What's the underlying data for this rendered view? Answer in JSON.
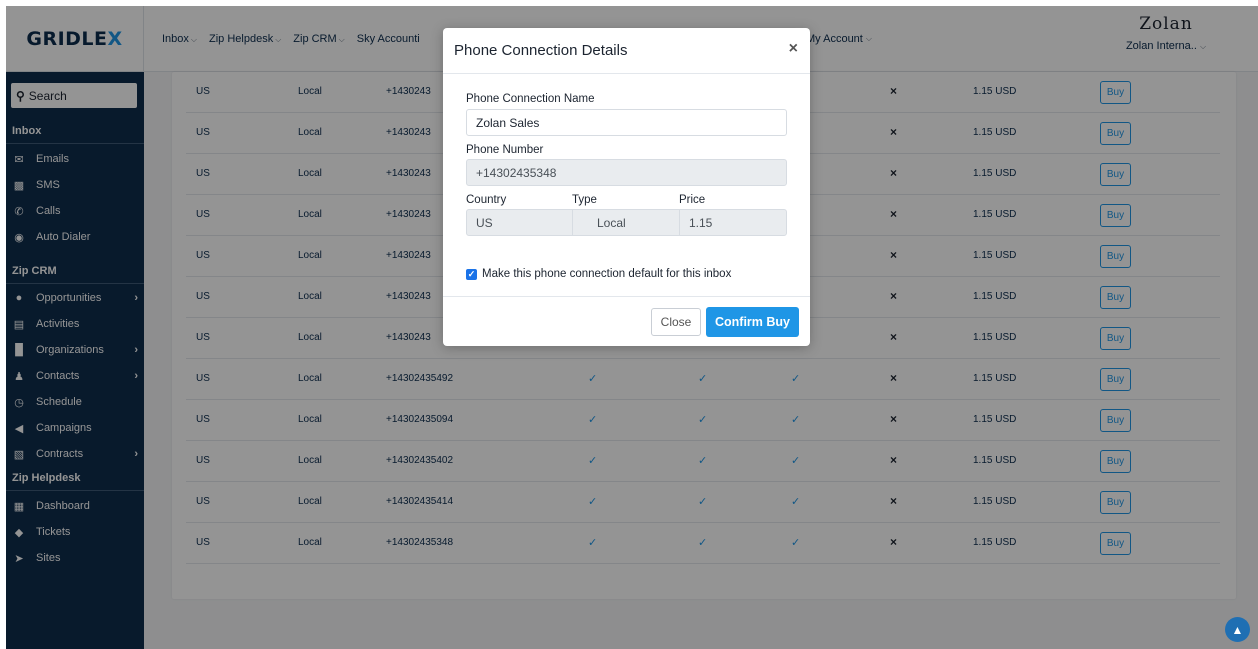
{
  "brand": {
    "name_part1": "GRIDLE",
    "name_part2": "X"
  },
  "topnav": {
    "items": [
      {
        "label": "Inbox"
      },
      {
        "label": "Zip Helpdesk"
      },
      {
        "label": "Zip CRM"
      },
      {
        "label": "Sky Accounti"
      }
    ],
    "my_account": "My Account",
    "company_logo": "Zolan",
    "company_name": "Zolan Interna.."
  },
  "sidebar": {
    "search_placeholder": "Search",
    "sections": {
      "inbox": "Inbox",
      "zip_crm": "Zip CRM",
      "zip_helpdesk": "Zip Helpdesk"
    },
    "inbox_items": [
      {
        "label": "Emails",
        "icon": "envelope-icon"
      },
      {
        "label": "SMS",
        "icon": "chat-icon"
      },
      {
        "label": "Calls",
        "icon": "phone-icon"
      },
      {
        "label": "Auto Dialer",
        "icon": "dialer-icon"
      }
    ],
    "crm_items": [
      {
        "label": "Opportunities",
        "icon": "lightbulb-icon",
        "has_arrow": true
      },
      {
        "label": "Activities",
        "icon": "activity-icon",
        "has_arrow": false
      },
      {
        "label": "Organizations",
        "icon": "building-icon",
        "has_arrow": true
      },
      {
        "label": "Contacts",
        "icon": "user-icon",
        "has_arrow": true
      },
      {
        "label": "Schedule",
        "icon": "clock-icon",
        "has_arrow": false
      },
      {
        "label": "Campaigns",
        "icon": "megaphone-icon",
        "has_arrow": false
      },
      {
        "label": "Contracts",
        "icon": "file-icon",
        "has_arrow": true
      }
    ],
    "helpdesk_items": [
      {
        "label": "Dashboard",
        "icon": "dashboard-icon"
      },
      {
        "label": "Tickets",
        "icon": "tag-icon"
      },
      {
        "label": "Sites",
        "icon": "cursor-icon"
      }
    ]
  },
  "table": {
    "rows": [
      {
        "country": "US",
        "type": "Local",
        "number": "+1430243",
        "x": "×",
        "price": "1.15 USD",
        "buy": "Buy"
      },
      {
        "country": "US",
        "type": "Local",
        "number": "+1430243",
        "x": "×",
        "price": "1.15 USD",
        "buy": "Buy"
      },
      {
        "country": "US",
        "type": "Local",
        "number": "+1430243",
        "x": "×",
        "price": "1.15 USD",
        "buy": "Buy"
      },
      {
        "country": "US",
        "type": "Local",
        "number": "+1430243",
        "x": "×",
        "price": "1.15 USD",
        "buy": "Buy"
      },
      {
        "country": "US",
        "type": "Local",
        "number": "+1430243",
        "x": "×",
        "price": "1.15 USD",
        "buy": "Buy"
      },
      {
        "country": "US",
        "type": "Local",
        "number": "+1430243",
        "x": "×",
        "price": "1.15 USD",
        "buy": "Buy"
      },
      {
        "country": "US",
        "type": "Local",
        "number": "+1430243",
        "x": "×",
        "price": "1.15 USD",
        "buy": "Buy"
      },
      {
        "country": "US",
        "type": "Local",
        "number": "+14302435492",
        "check_a": "✓",
        "check_b": "✓",
        "check_c": "✓",
        "x": "×",
        "price": "1.15 USD",
        "buy": "Buy"
      },
      {
        "country": "US",
        "type": "Local",
        "number": "+14302435094",
        "check_a": "✓",
        "check_b": "✓",
        "check_c": "✓",
        "x": "×",
        "price": "1.15 USD",
        "buy": "Buy"
      },
      {
        "country": "US",
        "type": "Local",
        "number": "+14302435402",
        "check_a": "✓",
        "check_b": "✓",
        "check_c": "✓",
        "x": "×",
        "price": "1.15 USD",
        "buy": "Buy"
      },
      {
        "country": "US",
        "type": "Local",
        "number": "+14302435414",
        "check_a": "✓",
        "check_b": "✓",
        "check_c": "✓",
        "x": "×",
        "price": "1.15 USD",
        "buy": "Buy"
      },
      {
        "country": "US",
        "type": "Local",
        "number": "+14302435348",
        "check_a": "✓",
        "check_b": "✓",
        "check_c": "✓",
        "x": "×",
        "price": "1.15 USD",
        "buy": "Buy"
      }
    ]
  },
  "modal": {
    "title": "Phone Connection Details",
    "close_icon": "×",
    "name_label": "Phone Connection Name",
    "name_value": "Zolan Sales",
    "number_label": "Phone Number",
    "number_value": "+14302435348",
    "country_label": "Country",
    "country_value": "US",
    "type_label": "Type",
    "type_value": "Local",
    "price_label": "Price",
    "price_value": "1.15",
    "default_checked": true,
    "default_label": "Make this phone connection default for this inbox",
    "close_button": "Close",
    "confirm_button": "Confirm Buy"
  },
  "colors": {
    "brand_navy": "#0f2d4d",
    "accent_blue": "#1f96e6"
  }
}
